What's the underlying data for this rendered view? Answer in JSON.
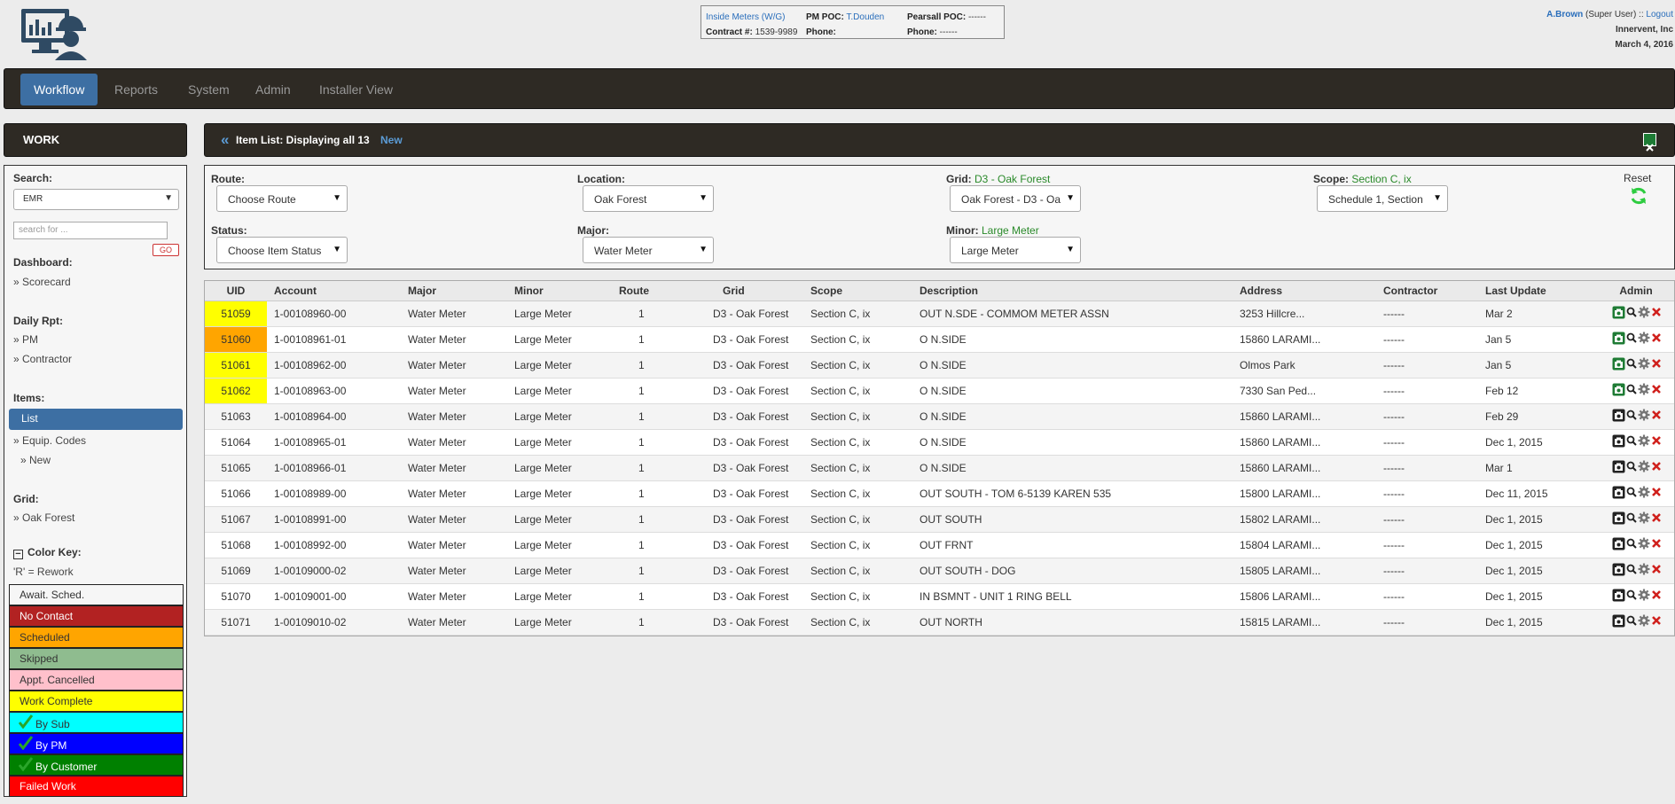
{
  "header": {
    "info": {
      "site": "Inside Meters (W/G)",
      "pm_poc_label": "PM POC:",
      "pm_poc_name": "T.Douden",
      "pearsall_poc_label": "Pearsall POC:",
      "pearsall_poc_value": "------",
      "contract_label": "Contract #:",
      "contract_value": "1539-9989",
      "phone_label": "Phone:",
      "phone_value": "",
      "phone2_label": "Phone:",
      "phone2_value": "------"
    },
    "user": {
      "name": "A.Brown",
      "role": "(Super User) ::",
      "logout": "Logout",
      "company": "Innervent, Inc",
      "date": "March 4, 2016"
    }
  },
  "nav": {
    "items": [
      "Workflow",
      "Reports",
      "System",
      "Admin",
      "Installer View"
    ],
    "active": "Workflow"
  },
  "sidebar": {
    "title": "WORK",
    "search_label": "Search:",
    "search_select": "EMR",
    "search_placeholder": "search for ...",
    "go": "GO",
    "dashboard_label": "Dashboard:",
    "scorecard": "» Scorecard",
    "daily_label": "Daily Rpt:",
    "pm": "» PM",
    "contractor": "» Contractor",
    "items_label": "Items:",
    "list": "List",
    "equip_codes": "» Equip. Codes",
    "new": "» New",
    "grid_label": "Grid:",
    "grid_value": "» Oak Forest",
    "color_key_label": "Color Key:",
    "rework": "'R' = Rework",
    "color_key": [
      {
        "label": "Await. Sched.",
        "bg": "#f6f6f6",
        "fg": "#333333",
        "check": false
      },
      {
        "label": "No Contact",
        "bg": "#b22222",
        "fg": "#ffffff",
        "check": false
      },
      {
        "label": "Scheduled",
        "bg": "#ffa500",
        "fg": "#333333",
        "check": false
      },
      {
        "label": "Skipped",
        "bg": "#8fbc8f",
        "fg": "#333333",
        "check": false
      },
      {
        "label": "Appt. Cancelled",
        "bg": "#ffc0cb",
        "fg": "#333333",
        "check": false
      },
      {
        "label": "Work Complete",
        "bg": "#ffff00",
        "fg": "#333333",
        "check": false
      },
      {
        "label": "By Sub",
        "bg": "#00ffff",
        "fg": "#333333",
        "check": true
      },
      {
        "label": "By PM",
        "bg": "#0000ff",
        "fg": "#ffffff",
        "check": true
      },
      {
        "label": "By Customer",
        "bg": "#008000",
        "fg": "#ffffff",
        "check": true
      },
      {
        "label": "Failed Work",
        "bg": "#ff0000",
        "fg": "#ffffff",
        "check": false
      }
    ]
  },
  "list_header": {
    "back": "«",
    "title": "Item List: Displaying all 13",
    "new": "New"
  },
  "filters": {
    "route_label": "Route:",
    "route_value": "Choose Route",
    "location_label": "Location:",
    "location_value": "Oak Forest",
    "grid_label": "Grid:",
    "grid_current": "D3 - Oak Forest",
    "grid_value": "Oak Forest - D3 - Oa",
    "scope_label": "Scope:",
    "scope_current": "Section C, ix",
    "scope_value": "Schedule 1, Section",
    "reset": "Reset",
    "status_label": "Status:",
    "status_value": "Choose Item Status",
    "major_label": "Major:",
    "major_value": "Water Meter",
    "minor_label": "Minor:",
    "minor_current": "Large Meter",
    "minor_value": "Large Meter"
  },
  "table": {
    "columns": [
      "UID",
      "Account",
      "Major",
      "Minor",
      "Route",
      "Grid",
      "Scope",
      "Description",
      "Address",
      "Contractor",
      "Last Update",
      "Admin"
    ],
    "rows": [
      {
        "uid": "51059",
        "account": "1-00108960-00",
        "major": "Water Meter",
        "minor": "Large Meter",
        "route": "1",
        "grid": "D3 - Oak Forest",
        "scope": "Section C, ix",
        "description": "OUT N.SDE - COMMOM METER ASSN",
        "address": "3253 Hillcre...",
        "contractor": "------",
        "updated": "Mar 2",
        "color": "#ffff00",
        "camera": "green"
      },
      {
        "uid": "51060",
        "account": "1-00108961-01",
        "major": "Water Meter",
        "minor": "Large Meter",
        "route": "1",
        "grid": "D3 - Oak Forest",
        "scope": "Section C, ix",
        "description": "O N.SIDE",
        "address": "15860 LARAMI...",
        "contractor": "------",
        "updated": "Jan 5",
        "color": "#ffa500",
        "camera": "green"
      },
      {
        "uid": "51061",
        "account": "1-00108962-00",
        "major": "Water Meter",
        "minor": "Large Meter",
        "route": "1",
        "grid": "D3 - Oak Forest",
        "scope": "Section C, ix",
        "description": "O N.SIDE",
        "address": "Olmos Park",
        "contractor": "------",
        "updated": "Jan 5",
        "color": "#ffff00",
        "camera": "green"
      },
      {
        "uid": "51062",
        "account": "1-00108963-00",
        "major": "Water Meter",
        "minor": "Large Meter",
        "route": "1",
        "grid": "D3 - Oak Forest",
        "scope": "Section C, ix",
        "description": "O N.SIDE",
        "address": "7330 San Ped...",
        "contractor": "------",
        "updated": "Feb 12",
        "color": "#ffff00",
        "camera": "green"
      },
      {
        "uid": "51063",
        "account": "1-00108964-00",
        "major": "Water Meter",
        "minor": "Large Meter",
        "route": "1",
        "grid": "D3 - Oak Forest",
        "scope": "Section C, ix",
        "description": "O N.SIDE",
        "address": "15860 LARAMI...",
        "contractor": "------",
        "updated": "Feb 29",
        "color": "",
        "camera": "black"
      },
      {
        "uid": "51064",
        "account": "1-00108965-01",
        "major": "Water Meter",
        "minor": "Large Meter",
        "route": "1",
        "grid": "D3 - Oak Forest",
        "scope": "Section C, ix",
        "description": "O N.SIDE",
        "address": "15860 LARAMI...",
        "contractor": "------",
        "updated": "Dec 1, 2015",
        "color": "",
        "camera": "black"
      },
      {
        "uid": "51065",
        "account": "1-00108966-01",
        "major": "Water Meter",
        "minor": "Large Meter",
        "route": "1",
        "grid": "D3 - Oak Forest",
        "scope": "Section C, ix",
        "description": "O N.SIDE",
        "address": "15860 LARAMI...",
        "contractor": "------",
        "updated": "Mar 1",
        "color": "",
        "camera": "black"
      },
      {
        "uid": "51066",
        "account": "1-00108989-00",
        "major": "Water Meter",
        "minor": "Large Meter",
        "route": "1",
        "grid": "D3 - Oak Forest",
        "scope": "Section C, ix",
        "description": "OUT SOUTH - TOM 6-5139 KAREN 535",
        "address": "15800 LARAMI...",
        "contractor": "------",
        "updated": "Dec 11, 2015",
        "color": "",
        "camera": "black"
      },
      {
        "uid": "51067",
        "account": "1-00108991-00",
        "major": "Water Meter",
        "minor": "Large Meter",
        "route": "1",
        "grid": "D3 - Oak Forest",
        "scope": "Section C, ix",
        "description": "OUT SOUTH",
        "address": "15802 LARAMI...",
        "contractor": "------",
        "updated": "Dec 1, 2015",
        "color": "",
        "camera": "black"
      },
      {
        "uid": "51068",
        "account": "1-00108992-00",
        "major": "Water Meter",
        "minor": "Large Meter",
        "route": "1",
        "grid": "D3 - Oak Forest",
        "scope": "Section C, ix",
        "description": "OUT FRNT",
        "address": "15804 LARAMI...",
        "contractor": "------",
        "updated": "Dec 1, 2015",
        "color": "",
        "camera": "black"
      },
      {
        "uid": "51069",
        "account": "1-00109000-02",
        "major": "Water Meter",
        "minor": "Large Meter",
        "route": "1",
        "grid": "D3 - Oak Forest",
        "scope": "Section C, ix",
        "description": "OUT SOUTH - DOG",
        "address": "15805 LARAMI...",
        "contractor": "------",
        "updated": "Dec 1, 2015",
        "color": "",
        "camera": "black"
      },
      {
        "uid": "51070",
        "account": "1-00109001-00",
        "major": "Water Meter",
        "minor": "Large Meter",
        "route": "1",
        "grid": "D3 - Oak Forest",
        "scope": "Section C, ix",
        "description": "IN BSMNT - UNIT 1 RING BELL",
        "address": "15806 LARAMI...",
        "contractor": "------",
        "updated": "Dec 1, 2015",
        "color": "",
        "camera": "black"
      },
      {
        "uid": "51071",
        "account": "1-00109010-02",
        "major": "Water Meter",
        "minor": "Large Meter",
        "route": "1",
        "grid": "D3 - Oak Forest",
        "scope": "Section C, ix",
        "description": "OUT NORTH",
        "address": "15815 LARAMI...",
        "contractor": "------",
        "updated": "Dec 1, 2015",
        "color": "",
        "camera": "black"
      }
    ]
  },
  "icons": {
    "logo": "worker-computer-icon",
    "excel": "excel-icon",
    "reset": "refresh-icon",
    "admin": [
      "camera-icon",
      "search-icon",
      "gear-icon",
      "delete-icon"
    ]
  }
}
